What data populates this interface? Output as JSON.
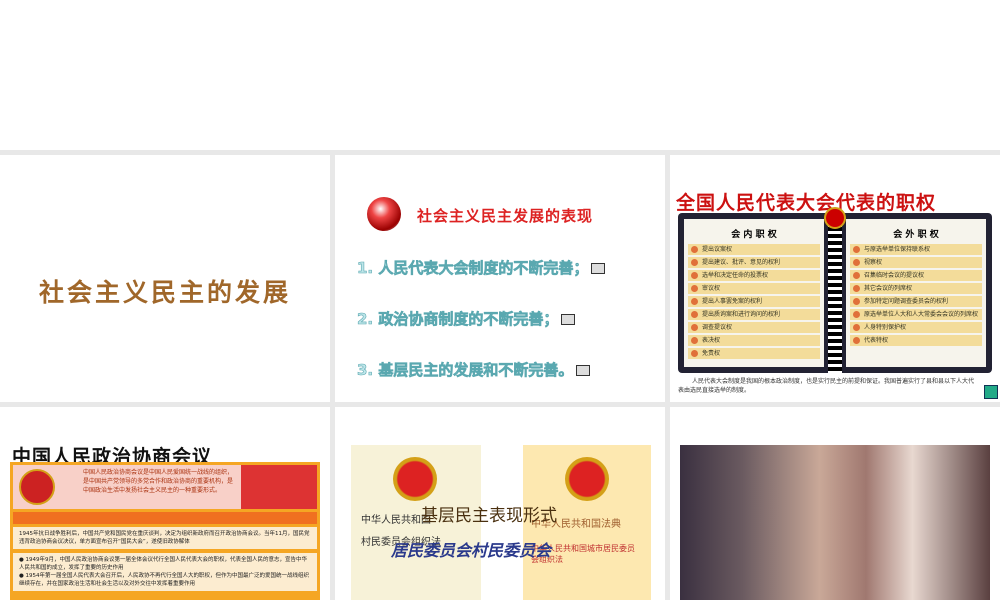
{
  "slides": [
    {
      "title": "社会主义民主的发展"
    },
    {
      "title": "社会主义民主发展的表现",
      "items": [
        "1. 人民代表大会制度的不断完善；",
        "2. 政治协商制度的不断完善；",
        "3. 基层民主的发展和不断完善。"
      ]
    },
    {
      "title": "全国人民代表大会代表的职权",
      "left_header": "会 内 职 权",
      "right_header": "会 外 职 权",
      "left_items": [
        "提出议案权",
        "提出建议、批评、意见的权利",
        "选举和决定任命的投票权",
        "审议权",
        "提出人事罢免案的权利",
        "提出质询案和进行询问的权利",
        "调查提议权",
        "表决权",
        "免责权"
      ],
      "right_items": [
        "与原选举单位保持联系权",
        "视察权",
        "召集临时会议的提议权",
        "其它会议的列席权",
        "参加特定问题调查委员会的权利",
        "原选举单位人大和人大常委会会议的列席权",
        "人身特别保护权",
        "代表特权"
      ],
      "caption": "人民代表大会制度是我国的根本政治制度，也是实行民主的前提和保证。我国普遍实行了县和县以下人大代表由选民直接选举的制度。"
    },
    {
      "title": "中国人民政治协商会议",
      "intro": "中国人民政治协商会议是中国人民爱国统一战线的组织，是中国共产党领导的多党合作和政治协商的重要机构，是中国政治生活中发扬社会主义民主的一种重要形式。",
      "p1": "1945年抗日战争胜利后，中国共产党和国民党在重庆谈判，决定为组织新政府而召开政治协商会议。当年11月，国民党违背政治协商会议决议，单方面宣布召开“国民大会”，遂使旧政协解体",
      "p2": "● 1949年9月，中国人民政治协商会议第一届全体会议代行全国人民代表大会的职权，代表全国人民的意志，宣告中华人民共和国的成立，发挥了重要的历史作用",
      "p3": "● 1954年第一届全国人民代表大会召开后，人民政协不再代行全国人大的职权，但作为中国最广泛的爱国统一战线组织继续存在，并在国家政治生活和社会生活以及对外交往中发挥着重要作用"
    },
    {
      "title": "基层民主表现形式",
      "subtitle": "居民委员会村民委员会",
      "book1_line1": "中华人民共和国",
      "book1_line2": "村民委员会组织法",
      "book2_line1": "中华人民共和国法典",
      "book2_line2": "中华人民共和国城市居民委员会组织法"
    },
    {}
  ]
}
